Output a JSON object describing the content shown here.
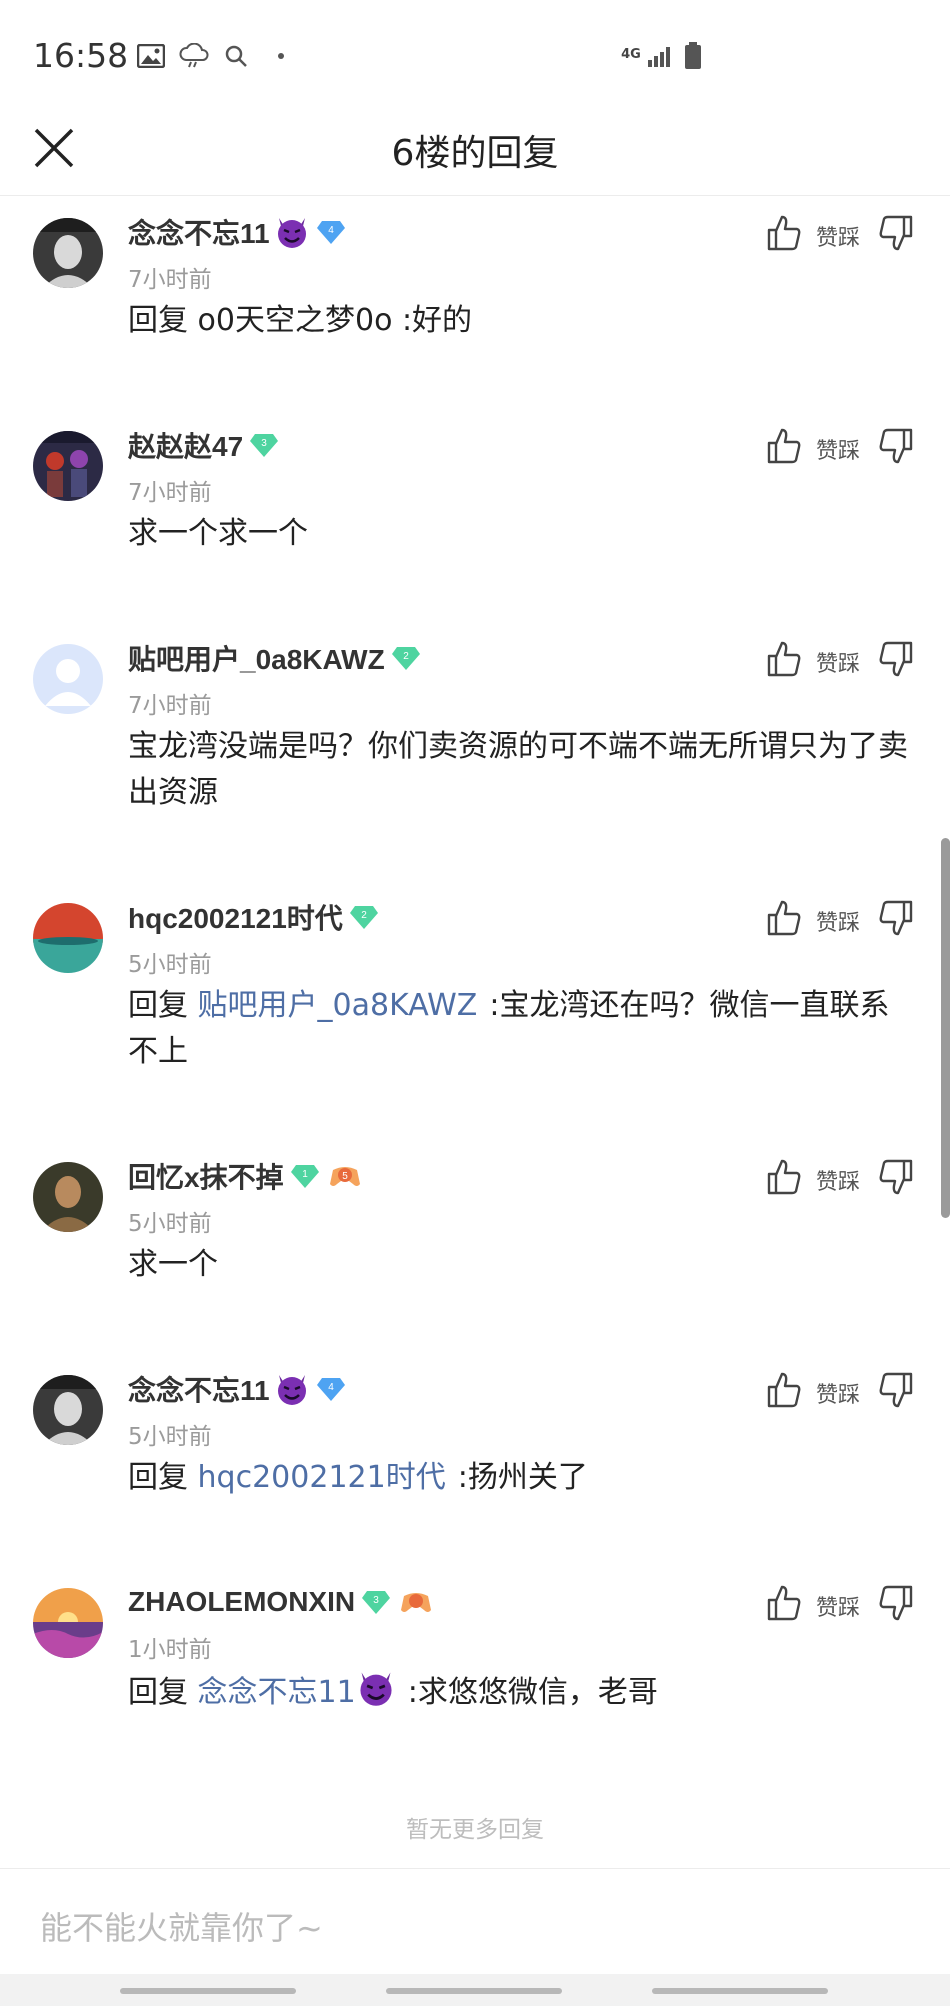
{
  "status_bar": {
    "time": "16:58",
    "network": "4G",
    "icons": [
      "image-icon",
      "cloud-icon",
      "search-icon",
      "dot-icon",
      "signal-icon",
      "battery-icon"
    ]
  },
  "header": {
    "title": "6楼的回复",
    "close_icon": "close-icon"
  },
  "colors": {
    "link": "#4e6ea5",
    "level_badge_green": "#4ed4a0",
    "level_badge_blue": "#4ea3f2",
    "muted_text": "#9b9b9b"
  },
  "actions": {
    "zan_cai_label": "赞踩"
  },
  "replies": [
    {
      "username": "念念不忘11",
      "badge_icon": "devil-emoji-icon",
      "level": "4",
      "level_color": "blue",
      "time": "7小时前",
      "content": "回复 o0天空之梦0o :好的"
    },
    {
      "username": "赵赵赵47",
      "level": "3",
      "level_color": "green",
      "time": "7小时前",
      "content": "求一个求一个"
    },
    {
      "username": "贴吧用户_0a8KAWZ",
      "level": "2",
      "level_color": "green",
      "time": "7小时前",
      "content": "宝龙湾没端是吗？你们卖资源的可不端不端无所谓只为了卖出资源"
    },
    {
      "username": "hqc2002121时代",
      "level": "2",
      "level_color": "green",
      "time": "5小时前",
      "content_prefix": "回复",
      "content_link": "贴吧用户_0a8KAWZ",
      "content_suffix": ":宝龙湾还在吗？微信一直联系不上"
    },
    {
      "username": "回忆x抹不掉",
      "level": "1",
      "level_color": "green",
      "extra_badge": "5",
      "time": "5小时前",
      "content": "求一个"
    },
    {
      "username": "念念不忘11",
      "badge_icon": "devil-emoji-icon",
      "level": "4",
      "level_color": "blue",
      "time": "5小时前",
      "content_prefix": "回复",
      "content_link": "hqc2002121时代",
      "content_suffix": ":扬州关了"
    },
    {
      "username": "ZHAOLEMONXIN",
      "level": "3",
      "level_color": "green",
      "extra_badge": "",
      "time": "1小时前",
      "content_prefix": "回复",
      "content_link": "念念不忘11",
      "content_suffix": ":求悠悠微信，老哥"
    }
  ],
  "footer": {
    "no_more": "暂无更多回复"
  },
  "input": {
    "placeholder": "能不能火就靠你了~"
  }
}
